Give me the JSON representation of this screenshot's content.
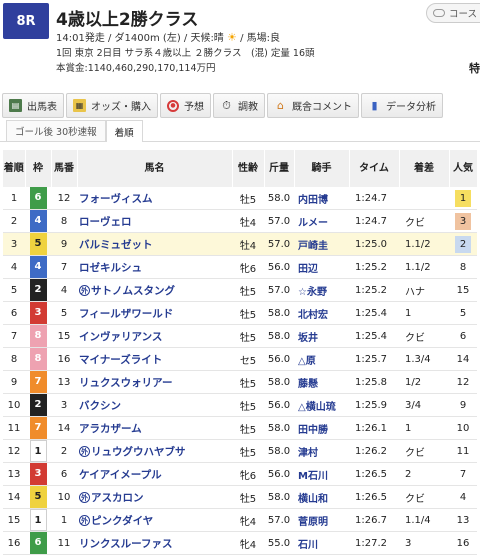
{
  "race": {
    "number": "8R",
    "title": "4歳以上2勝クラス",
    "info_line1_pre": "14:01発走 / ダ1400m (左) / 天候:晴",
    "info_line1_post": "/ 馬場:良",
    "info_line2": "1回 東京 2日目 サラ系４歳以上 ２勝クラス　(混) 定量 16頭",
    "info_line3": "本賞金:1140,460,290,170,114万円",
    "cut_char": "特",
    "course_label": "コース"
  },
  "tabs": [
    {
      "label": "出馬表",
      "icon": "shutsuba-icon"
    },
    {
      "label": "オッズ・購入",
      "icon": "odds-icon"
    },
    {
      "label": "予想",
      "icon": "yoso-icon"
    },
    {
      "label": "調教",
      "icon": "stopwatch-icon"
    },
    {
      "label": "厩舎コメント",
      "icon": "comment-icon"
    },
    {
      "label": "データ分析",
      "icon": "bar-chart-icon"
    }
  ],
  "subtabs": [
    {
      "label": "ゴール後 30秒速報",
      "active": false
    },
    {
      "label": "着順",
      "active": true
    }
  ],
  "columns": {
    "rank": "着順",
    "waku": "枠",
    "umaban": "馬番",
    "name": "馬名",
    "sexage": "性齢",
    "weight": "斤量",
    "jockey": "騎手",
    "time": "タイム",
    "margin": "着差",
    "pop": "人気"
  },
  "rows": [
    {
      "rank": "1",
      "waku": "6",
      "umaban": "12",
      "name": "フォーヴィスム",
      "gai": false,
      "sexage": "牡5",
      "weight": "58.0",
      "jockey": "内田博",
      "time": "1:24.7",
      "margin": "",
      "pop": "1"
    },
    {
      "rank": "2",
      "waku": "4",
      "umaban": "8",
      "name": "ローヴェロ",
      "gai": false,
      "sexage": "牡4",
      "weight": "57.0",
      "jockey": "ルメー",
      "time": "1:24.7",
      "margin": "クビ",
      "pop": "3"
    },
    {
      "rank": "3",
      "waku": "5",
      "umaban": "9",
      "name": "バルミュゼット",
      "gai": false,
      "sexage": "牡4",
      "weight": "57.0",
      "jockey": "戸崎圭",
      "time": "1:25.0",
      "margin": "1.1/2",
      "pop": "2"
    },
    {
      "rank": "4",
      "waku": "4",
      "umaban": "7",
      "name": "ロゼキルシュ",
      "gai": false,
      "sexage": "牝6",
      "weight": "56.0",
      "jockey": "田辺",
      "time": "1:25.2",
      "margin": "1.1/2",
      "pop": "8"
    },
    {
      "rank": "5",
      "waku": "2",
      "umaban": "4",
      "name": "サトノムスタング",
      "gai": true,
      "sexage": "牡5",
      "weight": "57.0",
      "jockey": "☆永野",
      "time": "1:25.2",
      "margin": "ハナ",
      "pop": "15"
    },
    {
      "rank": "6",
      "waku": "3",
      "umaban": "5",
      "name": "フィールザワールド",
      "gai": false,
      "sexage": "牡5",
      "weight": "58.0",
      "jockey": "北村宏",
      "time": "1:25.4",
      "margin": "1",
      "pop": "5"
    },
    {
      "rank": "7",
      "waku": "8",
      "umaban": "15",
      "name": "インヴァリアンス",
      "gai": false,
      "sexage": "牡5",
      "weight": "58.0",
      "jockey": "坂井",
      "time": "1:25.4",
      "margin": "クビ",
      "pop": "6"
    },
    {
      "rank": "8",
      "waku": "8",
      "umaban": "16",
      "name": "マイナーズライト",
      "gai": false,
      "sexage": "セ5",
      "weight": "56.0",
      "jockey": "△原",
      "time": "1:25.7",
      "margin": "1.3/4",
      "pop": "14"
    },
    {
      "rank": "9",
      "waku": "7",
      "umaban": "13",
      "name": "リュクスウォリアー",
      "gai": false,
      "sexage": "牡5",
      "weight": "58.0",
      "jockey": "藤懸",
      "time": "1:25.8",
      "margin": "1/2",
      "pop": "12"
    },
    {
      "rank": "10",
      "waku": "2",
      "umaban": "3",
      "name": "バクシン",
      "gai": false,
      "sexage": "牡5",
      "weight": "56.0",
      "jockey": "△横山琉",
      "time": "1:25.9",
      "margin": "3/4",
      "pop": "9"
    },
    {
      "rank": "11",
      "waku": "7",
      "umaban": "14",
      "name": "アラカザーム",
      "gai": false,
      "sexage": "牡5",
      "weight": "58.0",
      "jockey": "田中勝",
      "time": "1:26.1",
      "margin": "1",
      "pop": "10"
    },
    {
      "rank": "12",
      "waku": "1",
      "umaban": "2",
      "name": "リュウグウハヤブサ",
      "gai": true,
      "sexage": "牡5",
      "weight": "58.0",
      "jockey": "津村",
      "time": "1:26.2",
      "margin": "クビ",
      "pop": "11"
    },
    {
      "rank": "13",
      "waku": "3",
      "umaban": "6",
      "name": "ケイアイメープル",
      "gai": false,
      "sexage": "牝6",
      "weight": "56.0",
      "jockey": "M石川",
      "time": "1:26.5",
      "margin": "2",
      "pop": "7"
    },
    {
      "rank": "14",
      "waku": "5",
      "umaban": "10",
      "name": "アスカロン",
      "gai": true,
      "sexage": "牡5",
      "weight": "58.0",
      "jockey": "横山和",
      "time": "1:26.5",
      "margin": "クビ",
      "pop": "4"
    },
    {
      "rank": "15",
      "waku": "1",
      "umaban": "1",
      "name": "ピンクダイヤ",
      "gai": true,
      "sexage": "牝4",
      "weight": "57.0",
      "jockey": "菅原明",
      "time": "1:26.7",
      "margin": "1.1/4",
      "pop": "13"
    },
    {
      "rank": "16",
      "waku": "6",
      "umaban": "11",
      "name": "リンクスルーファス",
      "gai": false,
      "sexage": "牝4",
      "weight": "55.0",
      "jockey": "石川",
      "time": "1:27.2",
      "margin": "3",
      "pop": "16"
    }
  ],
  "gai_mark": "外",
  "colors": {
    "race_badge": "#2f3f9d",
    "link_text": "#253b91",
    "highlight_row": "#fdf8d9"
  }
}
